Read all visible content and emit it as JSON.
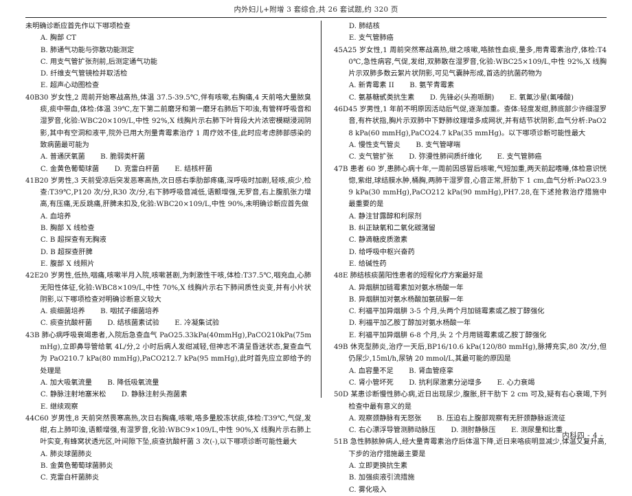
{
  "header": {
    "running_title": "内外妇儿+附增 3 套综合,共 26 套试题,约 320 页"
  },
  "footer": {
    "text": "内科四 - 4 -"
  },
  "left_column": {
    "questions": [
      {
        "id": "q39-tail",
        "stem_lines": [
          "未明确诊断应首先作以下哪项检查"
        ],
        "continued_from_previous": true,
        "option_rows": [
          [
            {
              "text": "A. 胸部 CT"
            }
          ],
          [
            {
              "text": "B. 肺通气功能与弥散功能测定"
            }
          ],
          [
            {
              "text": "C. 用支气管扩张剂前,后测定通气功能"
            }
          ],
          [
            {
              "text": "D. 纤维支气管镜检并取活检"
            }
          ],
          [
            {
              "text": "E. 超声心动图检查"
            }
          ]
        ]
      },
      {
        "id": "q40",
        "stem_lines": [
          "40B30 岁女性,2 周前开始寒战高热,体温 37.5-39.5℃,伴有咳嗽,右胸痛,4 天前咯大量脓臭痰,痰中带血,体检:体温 39℃,左下第二前磨牙和第一磨牙右肺后下叩浊,有管样呼吸音和湿罗音,化验:WBC20×109/L,中性 92%,X 线胸片示右肺下叶背段大片浓密模糊浸润阴影,其中有空洞和液平,院外已用大剂量青霉素治疗 1 周疗效不佳,此时应考虑肺部感染的致病菌最可能为"
        ],
        "option_rows": [
          [
            {
              "text": "A. 普通厌氧菌"
            },
            {
              "gap": "gap-m"
            },
            {
              "text": "B. 脆弱类杆菌"
            }
          ],
          [
            {
              "text": "C. 金黄色葡萄球菌"
            },
            {
              "gap": "gap-m"
            },
            {
              "text": "D. 克雷白杆菌"
            },
            {
              "gap": "gap-m"
            },
            {
              "text": "E. 结核杆菌"
            }
          ]
        ]
      },
      {
        "id": "q41",
        "stem_lines": [
          "41B20 岁男性,3 天前受凉后突发恶寒高热,次日感右季肋部疼痛,深呼吸时加剧,轻咳,痰少,检查:T39℃,P120 次/分,R30 次/分,右下肺呼吸音减低,语颤增强,无罗音,右上腹肌张力增高,有压痛,无反跳痛,肝脾未扣及,化验:WBC20×109/L,中性 90%,未明确诊断应首先做"
        ],
        "option_rows": [
          [
            {
              "text": "A. 血培养"
            }
          ],
          [
            {
              "text": "B. 胸部 X 线检查"
            }
          ],
          [
            {
              "text": "C. B 超探查有无胸液"
            }
          ],
          [
            {
              "text": "D. B 超探查肝脾"
            }
          ],
          [
            {
              "text": "E. 腹部 X 线照片"
            }
          ]
        ]
      },
      {
        "id": "q42",
        "stem_lines": [
          "42E20 岁男性,低热,咽痛,咳嗽半月入院,咳嗽甚剧,为刺激性干咳,体检:T37.5℃,咽充血,心肺无阳性体征,化验:WBC8×109/L,中性 70%,X 线胸片示右下肺间质性炎变,并有小片状阴影,以下哪项检查对明确诊断意义较大"
        ],
        "option_rows": [
          [
            {
              "text": "A. 痰细菌培养"
            },
            {
              "gap": "gap-m"
            },
            {
              "text": "B. 咽拭子细菌培养"
            }
          ],
          [
            {
              "text": "C. 痰查抗酸杆菌"
            },
            {
              "gap": "gap-m"
            },
            {
              "text": "D. 结核菌素试验"
            },
            {
              "gap": "gap-m"
            },
            {
              "text": "E. 冷凝集试验"
            }
          ]
        ]
      },
      {
        "id": "q43",
        "stem_lines": [
          "43B 肺心病呼吸衰竭患者,入院后急查血气 PaO25.33kPa(40mmHg),PaCO210kPa(75mmHg),立即鼻导管给氧 4L/分,2 小时后病人发绀减轻,但神志不清呈昏迷状态,复查血气为 PaO210.7 kPa(80 mmHg),PaCO212.7 kPa(95 mmHg),此时首先应立即给予的处理是"
        ],
        "option_rows": [
          [
            {
              "text": "A. 加大吸氧流量"
            },
            {
              "gap": "gap-m"
            },
            {
              "text": "B. 降低吸氧流量"
            }
          ],
          [
            {
              "text": "C. 静脉注射地塞米松"
            },
            {
              "gap": "gap-m"
            },
            {
              "text": "D. 静脉注射头孢菌素"
            }
          ],
          [
            {
              "text": "E. 继续观察"
            }
          ]
        ]
      },
      {
        "id": "q44",
        "stem_lines": [
          "44C60 岁男性,8 天前突然畏寒高热,次日右胸痛,咳嗽,咯多量胶冻状痰,体检:T39℃,气促,发绀,右上肺叩浊,语颤增强,有湿罗音,化验:WBC9×109/L,中性 90%,X 线胸片示右肺上叶实变,有蜂窝状透光区,叶间隙下坠,痰查抗酸杆菌 3 次(-),以下哪项诊断可能性最大"
        ],
        "option_rows": [
          [
            {
              "text": "A. 肺炎球菌肺炎"
            }
          ],
          [
            {
              "text": "B. 金黄色葡萄球菌肺炎"
            }
          ],
          [
            {
              "text": "C. 克雷白杆菌肺炎"
            }
          ]
        ]
      }
    ]
  },
  "right_column": {
    "questions": [
      {
        "id": "q44-tail",
        "continued_from_previous": true,
        "stem_lines": [],
        "option_rows": [
          [
            {
              "text": "D. 肺结核"
            }
          ],
          [
            {
              "text": "E. 支气管肺癌"
            }
          ]
        ]
      },
      {
        "id": "q45",
        "stem_lines": [
          "45A25 岁女性,1 周前突然寒战高热,继之咳嗽,咯脓性血痰,量多,用青霉素治疗,体检:T40℃,急性病容,气促,发绀,双肺散在湿罗音,化验:WBC25×109/L,中性 92%,X 线胸片示双肺多数云絮片状阴影,可见气囊肿形成,首选的抗菌药物为"
        ],
        "option_rows": [
          [
            {
              "text": "A. 新青霉素 II"
            },
            {
              "gap": "gap-m"
            },
            {
              "text": "B. 氨苄青霉素"
            }
          ],
          [
            {
              "text": "C. 氨基糖甙类抗生素"
            },
            {
              "gap": "gap-m"
            },
            {
              "text": "D. 先锋必(头孢哌酮)"
            },
            {
              "gap": "gap-m"
            },
            {
              "text": "E. 氧氟沙星(氟嗪酸)"
            }
          ]
        ]
      },
      {
        "id": "q46",
        "stem_lines": [
          "46D45 岁男性,1 年前不明原因活动后气促,逐渐加重。查体:轻度发绀,肺底部少许细湿罗音,有杵状指,胸片示双肺中下野肺纹理增多成网状,并有结节状阴影,血气分析:PaO28 kPa(60 mmHg),PaCO24.7 kPa(35 mmHg)。以下哪项诊断可能性最大"
        ],
        "option_rows": [
          [
            {
              "text": "A. 慢性支气管炎"
            },
            {
              "gap": "gap-m"
            },
            {
              "text": "B. 支气管哮喘"
            }
          ],
          [
            {
              "text": "C. 支气管扩张"
            },
            {
              "gap": "gap-m"
            },
            {
              "text": "D. 弥漫性肺间质纤维化"
            },
            {
              "gap": "gap-m"
            },
            {
              "text": "E. 支气管肺癌"
            }
          ]
        ]
      },
      {
        "id": "q47",
        "stem_lines": [
          "47B 患者 60 岁,患肺心病十年,一周前因感冒后咳嗽,气短加重,两天前起嗜睡,体检意识恍惚,紫绀,球结膜水肿,桶胸,两肺干湿罗音,心音正常,肝肋下 1 cm,血气分析:PaO23.99 kPa(30 mmHg),PaCO212 kPa(90 mmHg),PH7.28,在下述抢救治疗措施中最重要的是"
        ],
        "option_rows": [
          [
            {
              "text": "A. 静注甘露醇和利尿剂"
            }
          ],
          [
            {
              "text": "B. 纠正缺氧和二氧化碳潴留"
            }
          ],
          [
            {
              "text": "C. 静滴糖皮质激素"
            }
          ],
          [
            {
              "text": "D. 给呼吸中枢兴奋药"
            }
          ],
          [
            {
              "text": "E. 给碱性药"
            }
          ]
        ]
      },
      {
        "id": "q48",
        "stem_lines": [
          "48E 肺结核痰菌阳性患者的短程化疗方案最好是"
        ],
        "option_rows": [
          [
            {
              "text": "A. 异烟肼加链霉素加对氨水杨酸一年"
            }
          ],
          [
            {
              "text": "B. 异烟肼加对氨水杨酸加氨硫脲一年"
            }
          ],
          [
            {
              "text": "C. 利福平加异烟肼 3-5 个月,头两个月加链霉素或乙胺丁醇强化"
            }
          ],
          [
            {
              "text": "D. 利福平加乙胺丁醇加对氨水杨酸一年"
            }
          ],
          [
            {
              "text": "E. 利福平加异烟肼 6-8 个月,头 2 个月用链霉素或乙胺丁醇强化"
            }
          ]
        ]
      },
      {
        "id": "q49",
        "stem_lines": [
          "49B 休克型肺炎,治疗一天后,BP16/10.6 kPa(120/80 mmHg),脉搏充实,80 次/分,但仍尿少,15ml/h,尿钠 20 mmol/L,其最可能的原因是"
        ],
        "option_rows": [
          [
            {
              "text": "A. 血容量不足"
            },
            {
              "gap": "gap-m"
            },
            {
              "text": "B. 肾血管痉挛"
            }
          ],
          [
            {
              "text": "C. 肾小管坏死"
            },
            {
              "gap": "gap-m"
            },
            {
              "text": "D. 抗利尿激素分泌增多"
            },
            {
              "gap": "gap-m"
            },
            {
              "text": "E. 心力衰竭"
            }
          ]
        ]
      },
      {
        "id": "q50",
        "stem_lines": [
          "50D 某患诊断慢性肺心病,近日出现尿少,腹胀,肝干肋下 2 cm 可及,疑有右心衰竭,下列检查中最有意义的是"
        ],
        "option_rows": [
          [
            {
              "text": "A. 观察颈静脉有无怒张"
            },
            {
              "gap": "gap-m"
            },
            {
              "text": "B. 压迫右上腹部观察有无肝颈静脉返流征"
            }
          ],
          [
            {
              "text": "C. 右心漂浮导管测肺动脉压"
            },
            {
              "gap": "gap-m"
            },
            {
              "text": "D. 测肘静脉压"
            },
            {
              "gap": "gap-m"
            },
            {
              "text": "E. 测尿量和比重"
            }
          ]
        ]
      },
      {
        "id": "q51",
        "stem_lines": [
          "51B 急性肺脓肿病人,经大量青霉素治疗后体温下降,近日来咯痰明显减少,体温又复升高,下步的治疗措施最主要是"
        ],
        "option_rows": [
          [
            {
              "text": "A. 立即更换抗生素"
            }
          ],
          [
            {
              "text": "B. 加强痰液引流措施"
            }
          ],
          [
            {
              "text": "C. 雾化吸入"
            }
          ]
        ]
      }
    ]
  }
}
